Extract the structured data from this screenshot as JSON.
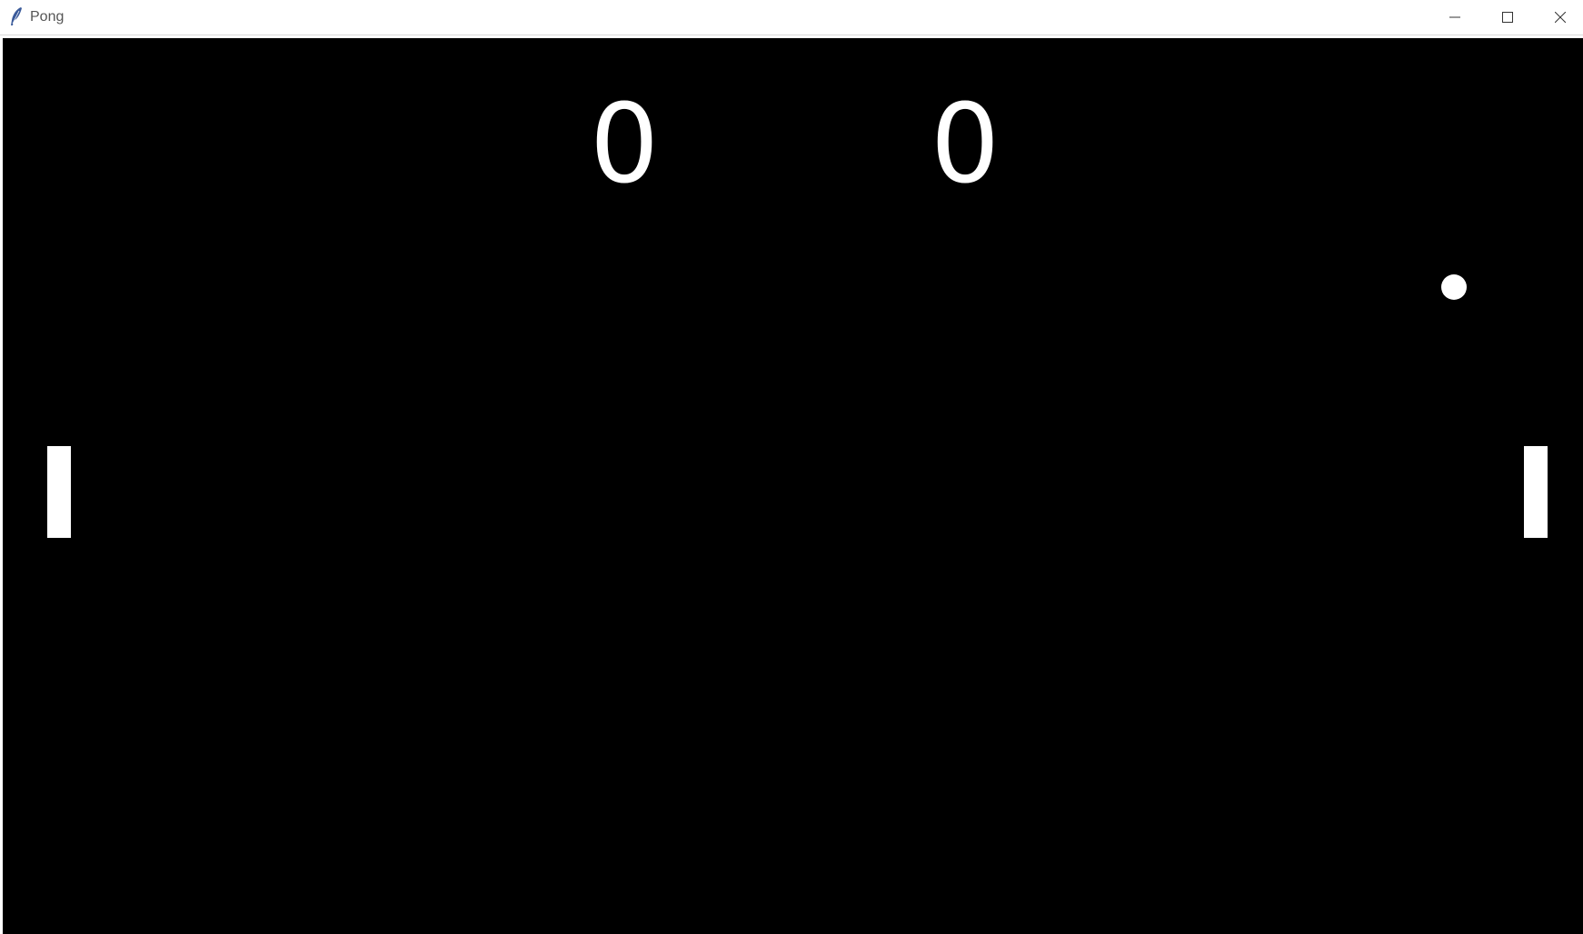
{
  "window": {
    "title": "Pong",
    "app_icon": "feather-icon",
    "controls": {
      "minimize_icon": "minimize-icon",
      "maximize_icon": "maximize-icon",
      "close_icon": "close-icon"
    }
  },
  "game": {
    "background_color": "#000000",
    "foreground_color": "#ffffff",
    "score": {
      "player_a": "0",
      "player_b": "0"
    }
  }
}
